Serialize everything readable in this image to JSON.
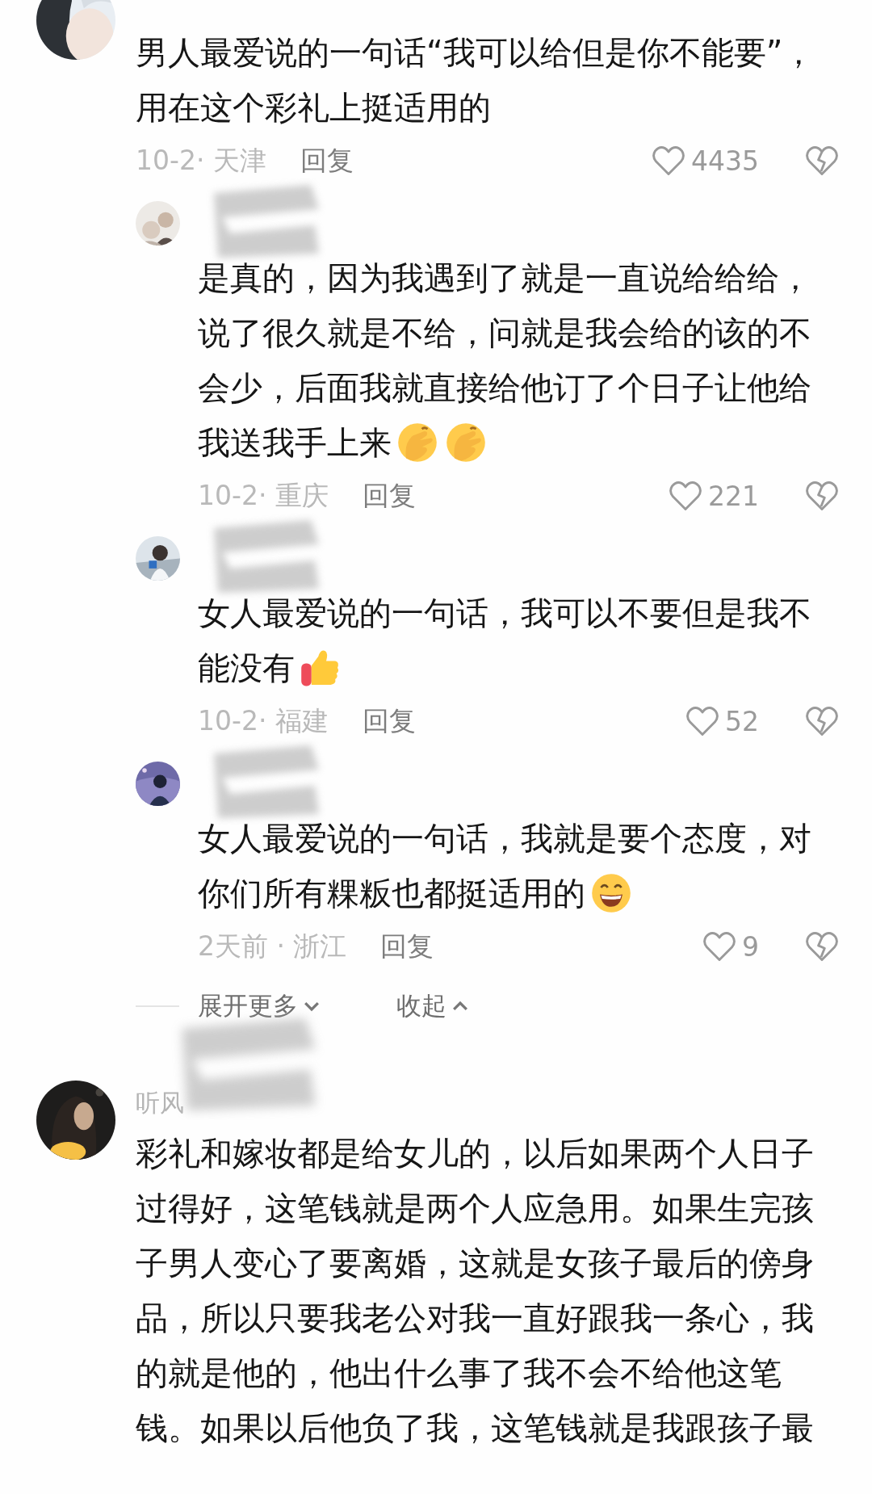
{
  "comments": [
    {
      "avatar": {
        "kind": "picture"
      },
      "lines": [
        "男人最爱说的一句话“我可以给但是你不能要”，",
        "用在这个彩礼上挺适用的"
      ],
      "meta": "10-2· 天津",
      "reply_label": "回复",
      "likes": "4435",
      "replies": [
        {
          "name": {
            "redacted": true
          },
          "lines": [
            "是真的，因为我遇到了就是一直说给给给，",
            "说了很久就是不给，问就是我会给的该的不",
            "会少，后面我就直接给他订了个日子让他给",
            "我送我手上来"
          ],
          "emoji": [
            {
              "kind": "facepalm"
            },
            {
              "kind": "facepalm"
            }
          ],
          "meta": "10-2· 重庆",
          "reply_label": "回复",
          "likes": "221"
        },
        {
          "name": {
            "redacted": true
          },
          "lines": [
            "女人最爱说的一句话，我可以不要但是我不",
            "能没有"
          ],
          "emoji": [
            {
              "kind": "thumbs-up"
            }
          ],
          "meta": "10-2· 福建",
          "reply_label": "回复",
          "likes": "52"
        },
        {
          "name": {
            "redacted": true
          },
          "lines": [
            "女人最爱说的一句话，我就是要个态度，对",
            "你们所有粿粄也都挺适用的"
          ],
          "emoji": [
            {
              "kind": "grin"
            }
          ],
          "meta": "2天前 · 浙江",
          "reply_label": "回复",
          "likes": "9"
        }
      ],
      "thread_controls": {
        "expand": "展开更多",
        "collapse": "收起"
      }
    },
    {
      "avatar": {
        "kind": "picture"
      },
      "name": {
        "text": "听风",
        "redacted": true
      },
      "lines": [
        "彩礼和嫁妆都是给女儿的，以后如果两个人日子",
        "过得好，这笔钱就是两个人应急用。如果生完孩",
        "子男人变心了要离婚，这就是女孩子最后的傍身",
        "品，所以只要我老公对我一直好跟我一条心，我",
        "的就是他的，他出什么事了我不会不给他这笔",
        "钱。如果以后他负了我，这笔钱就是我跟孩子最"
      ]
    }
  ]
}
